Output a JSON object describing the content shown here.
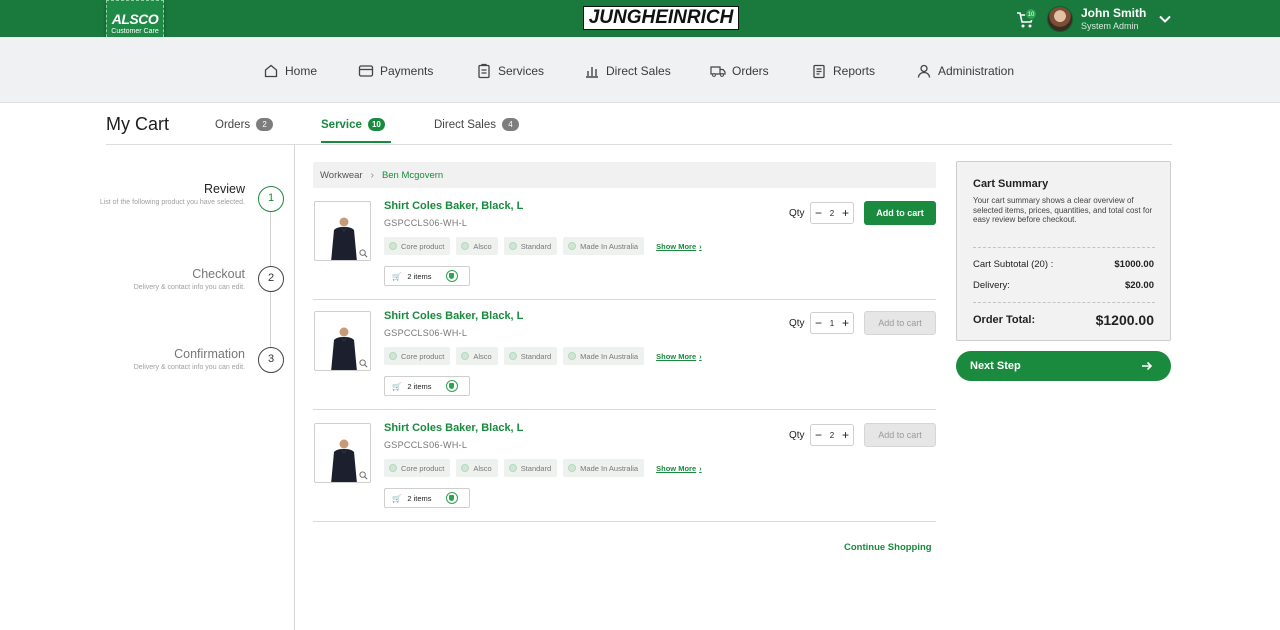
{
  "header": {
    "logo_title": "ALSCO",
    "logo_subtitle": "Customer Care",
    "brand": "JUNGHEINRICH",
    "cart_count": "10",
    "user_name": "John Smith",
    "user_role": "System Admin"
  },
  "nav": [
    {
      "label": "Home",
      "icon": "home-icon"
    },
    {
      "label": "Payments",
      "icon": "card-icon"
    },
    {
      "label": "Services",
      "icon": "clipboard-icon"
    },
    {
      "label": "Direct Sales",
      "icon": "bar-chart-icon"
    },
    {
      "label": "Orders",
      "icon": "truck-icon"
    },
    {
      "label": "Reports",
      "icon": "report-icon"
    },
    {
      "label": "Administration",
      "icon": "user-icon"
    }
  ],
  "page": {
    "title": "My Cart",
    "tabs": [
      {
        "label": "Orders",
        "count": "2"
      },
      {
        "label": "Service",
        "count": "10"
      },
      {
        "label": "Direct Sales",
        "count": "4"
      }
    ]
  },
  "steps": [
    {
      "number": "1",
      "title": "Review",
      "desc": "List of the following product you have selected."
    },
    {
      "number": "2",
      "title": "Checkout",
      "desc": "Delivery & contact info you can edit."
    },
    {
      "number": "3",
      "title": "Confirmation",
      "desc": "Delivery & contact info you can edit."
    }
  ],
  "breadcrumb": {
    "parent": "Workwear",
    "current": "Ben Mcgovern"
  },
  "products": [
    {
      "name": "Shirt Coles Baker, Black, L",
      "sku": "GSPCCLS06-WH-L",
      "tags": [
        "Core product",
        "Alsco",
        "Standard",
        "Made In Australia"
      ],
      "show_more": "Show More",
      "items": "2 items",
      "qty_label": "Qty",
      "qty": "2",
      "add_label": "Add to cart",
      "add_enabled": true
    },
    {
      "name": "Shirt Coles Baker, Black, L",
      "sku": "GSPCCLS06-WH-L",
      "tags": [
        "Core product",
        "Alsco",
        "Standard",
        "Made In Australia"
      ],
      "show_more": "Show More",
      "items": "2 items",
      "qty_label": "Qty",
      "qty": "1",
      "add_label": "Add to cart",
      "add_enabled": false
    },
    {
      "name": "Shirt Coles Baker, Black, L",
      "sku": "GSPCCLS06-WH-L",
      "tags": [
        "Core product",
        "Alsco",
        "Standard",
        "Made In Australia"
      ],
      "show_more": "Show More",
      "items": "2 items",
      "qty_label": "Qty",
      "qty": "2",
      "add_label": "Add to cart",
      "add_enabled": false
    }
  ],
  "continue_label": "Continue Shopping",
  "summary": {
    "title": "Cart Summary",
    "desc": "Your cart summary shows a clear overview of selected items, prices, quantities, and total cost for easy review before checkout.",
    "subtotal_label": "Cart Subtotal (20) :",
    "subtotal_value": "$1000.00",
    "delivery_label": "Delivery:",
    "delivery_value": "$20.00",
    "total_label": "Order Total:",
    "total_value": "$1200.00",
    "next_label": "Next Step"
  },
  "colors": {
    "primary": "#1a7a3e",
    "accent": "#1a8a3e",
    "brand_red": "#d3101a"
  }
}
